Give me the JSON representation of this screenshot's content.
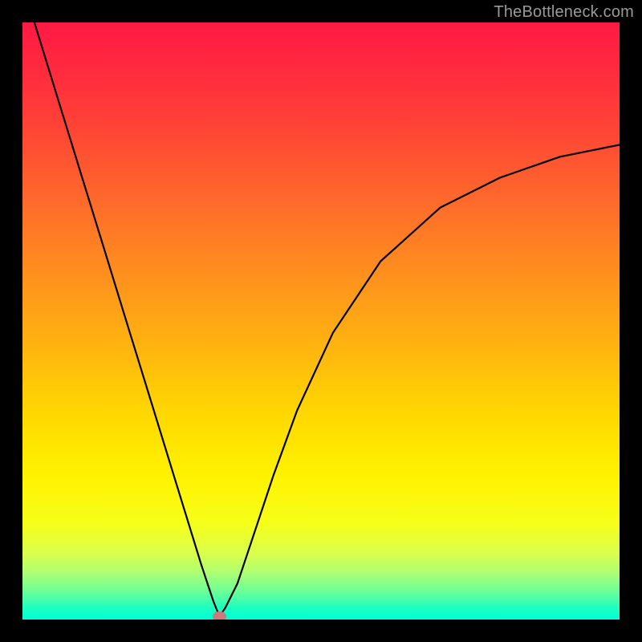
{
  "watermark": "TheBottleneck.com",
  "colors": {
    "frame_bg": "#000000",
    "curve_stroke": "#000000",
    "dot_fill": "#c97a7a",
    "gradient_top": "#ff1a43",
    "gradient_bottom": "#00ffd6"
  },
  "chart_data": {
    "type": "line",
    "title": "",
    "xlabel": "",
    "ylabel": "",
    "xlim": [
      0,
      100
    ],
    "ylim": [
      0,
      100
    ],
    "gradient_background": true,
    "series": [
      {
        "name": "bottleneck-curve",
        "x": [
          2,
          6,
          10,
          14,
          18,
          22,
          26,
          30,
          32,
          33,
          34,
          36,
          38,
          42,
          46,
          52,
          60,
          70,
          80,
          90,
          100
        ],
        "y": [
          100,
          87,
          74,
          61,
          48,
          35,
          22,
          9,
          3,
          0.5,
          2,
          6,
          12,
          24,
          35,
          48,
          60,
          69,
          74,
          77.5,
          79.5
        ]
      }
    ],
    "marker": {
      "name": "optimal-point",
      "x": 33,
      "y": 0.5
    },
    "annotations": []
  }
}
